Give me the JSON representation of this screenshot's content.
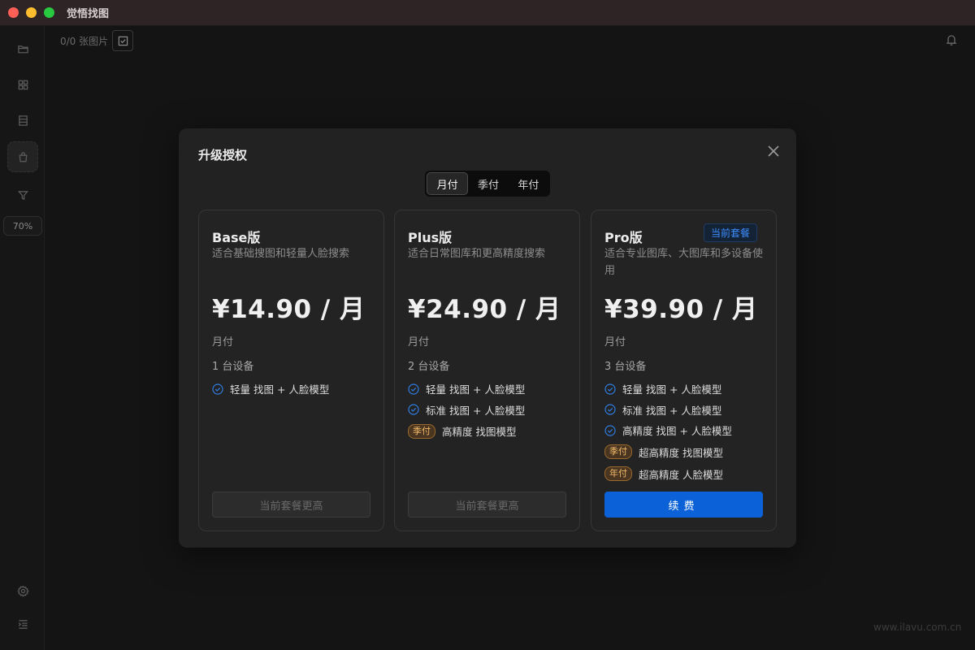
{
  "window": {
    "title": "觉悟找图"
  },
  "toolbar": {
    "count": "0/0 张图片"
  },
  "sidebar": {
    "zoom": "70%"
  },
  "watermark": "www.ilavu.com.cn",
  "modal": {
    "title": "升级授权",
    "billing_tabs": [
      "月付",
      "季付",
      "年付"
    ],
    "selected_tab": "月付",
    "plans": [
      {
        "name": "Base版",
        "desc": "适合基础搜图和轻量人脸搜索",
        "price": "¥14.90 / 月",
        "period": "月付",
        "devices": "1 台设备",
        "features": [
          {
            "text": "轻量 找图 + 人脸模型",
            "tag": ""
          }
        ],
        "button": "当前套餐更高",
        "badge": ""
      },
      {
        "name": "Plus版",
        "desc": "适合日常图库和更高精度搜索",
        "price": "¥24.90 / 月",
        "period": "月付",
        "devices": "2 台设备",
        "features": [
          {
            "text": "轻量 找图 + 人脸模型",
            "tag": ""
          },
          {
            "text": "标准 找图 + 人脸模型",
            "tag": ""
          },
          {
            "text": "高精度 找图模型",
            "tag": "季付"
          }
        ],
        "button": "当前套餐更高",
        "badge": ""
      },
      {
        "name": "Pro版",
        "desc": "适合专业图库、大图库和多设备使用",
        "price": "¥39.90 / 月",
        "period": "月付",
        "devices": "3 台设备",
        "features": [
          {
            "text": "轻量 找图 + 人脸模型",
            "tag": ""
          },
          {
            "text": "标准 找图 + 人脸模型",
            "tag": ""
          },
          {
            "text": "高精度 找图 + 人脸模型",
            "tag": ""
          },
          {
            "text": "超高精度 找图模型",
            "tag": "季付"
          },
          {
            "text": "超高精度 人脸模型",
            "tag": "年付"
          }
        ],
        "button": "续费",
        "badge": "当前套餐"
      }
    ]
  },
  "colors": {
    "accent": "#0b62d8",
    "badge_text": "#3d8eff",
    "tag_orange": "#f0b86a"
  }
}
